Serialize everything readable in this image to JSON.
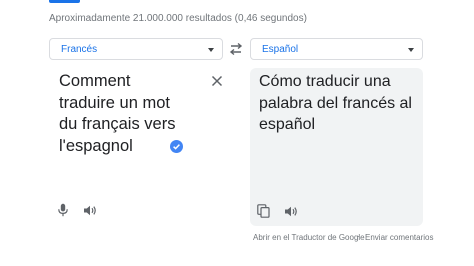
{
  "results_stats": "Aproximadamente 21.000.000 resultados (0,46 segundos)",
  "source": {
    "language": "Francés",
    "text_lines": [
      "Comment",
      "traduire un mot",
      "du français vers",
      "l'espagnol"
    ]
  },
  "target": {
    "language": "Español",
    "text_lines": [
      "Cómo traducir una",
      "palabra del francés al",
      "español"
    ]
  },
  "footer": {
    "open_in_translate": "Abrir en el Traductor de Google",
    "separator": "·",
    "send_feedback": "Enviar comentarios"
  },
  "icons": {
    "swap": "swap-arrows-icon",
    "clear": "close-icon",
    "verified": "verified-check-icon",
    "mic": "microphone-icon",
    "listen": "speaker-icon",
    "copy": "copy-icon"
  },
  "colors": {
    "accent": "#1a73e8",
    "muted_text": "#70757a",
    "panel_bg": "#f1f3f4",
    "icon": "#5f6368"
  }
}
